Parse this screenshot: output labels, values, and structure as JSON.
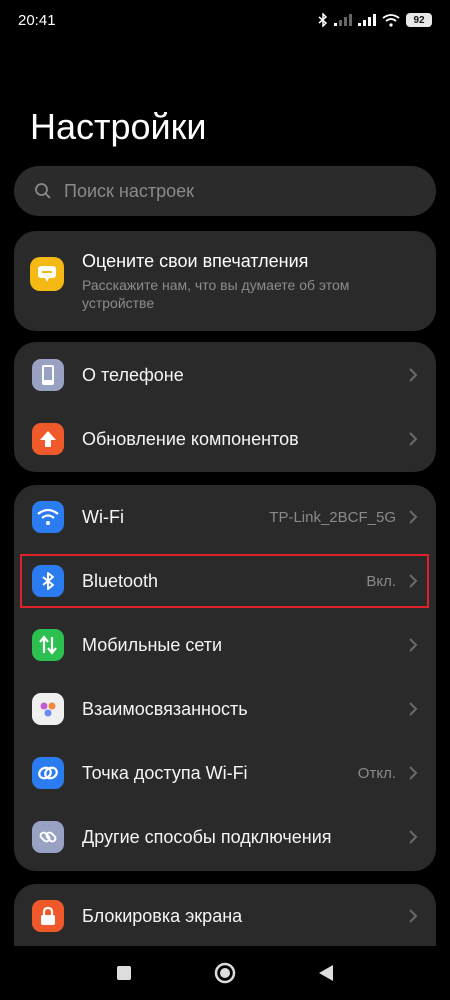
{
  "status": {
    "time": "20:41",
    "battery": "92"
  },
  "title": "Настройки",
  "search": {
    "placeholder": "Поиск настроек"
  },
  "feedback": {
    "title": "Оцените свои впечатления",
    "subtitle": "Расскажите нам, что вы думаете об этом устройстве"
  },
  "group1": [
    {
      "label": "О телефоне",
      "icon": "phone-icon",
      "color": "#9aa2c4"
    },
    {
      "label": "Обновление компонентов",
      "icon": "update-arrow-icon",
      "color": "#f05a2a"
    }
  ],
  "group2": [
    {
      "label": "Wi-Fi",
      "value": "TP-Link_2BCF_5G",
      "icon": "wifi-icon",
      "color": "#2a7cf0"
    },
    {
      "label": "Bluetooth",
      "value": "Вкл.",
      "icon": "bluetooth-icon",
      "color": "#2a7cf0"
    },
    {
      "label": "Мобильные сети",
      "value": "",
      "icon": "mobile-data-icon",
      "color": "#2bc04f"
    },
    {
      "label": "Взаимосвязанность",
      "value": "",
      "icon": "connectivity-icon",
      "color": "#f0f0f0"
    },
    {
      "label": "Точка доступа Wi-Fi",
      "value": "Откл.",
      "icon": "hotspot-icon",
      "color": "#2a7cf0"
    },
    {
      "label": "Другие способы подключения",
      "value": "",
      "icon": "link-icon",
      "color": "#9aa2c4"
    }
  ],
  "group3": [
    {
      "label": "Блокировка экрана",
      "icon": "lock-icon",
      "color": "#f05a2a"
    }
  ],
  "colors": {
    "accent": "#2a7cf0",
    "highlight": "#e0202a",
    "background": "#000000",
    "card": "#2a2a2a"
  }
}
